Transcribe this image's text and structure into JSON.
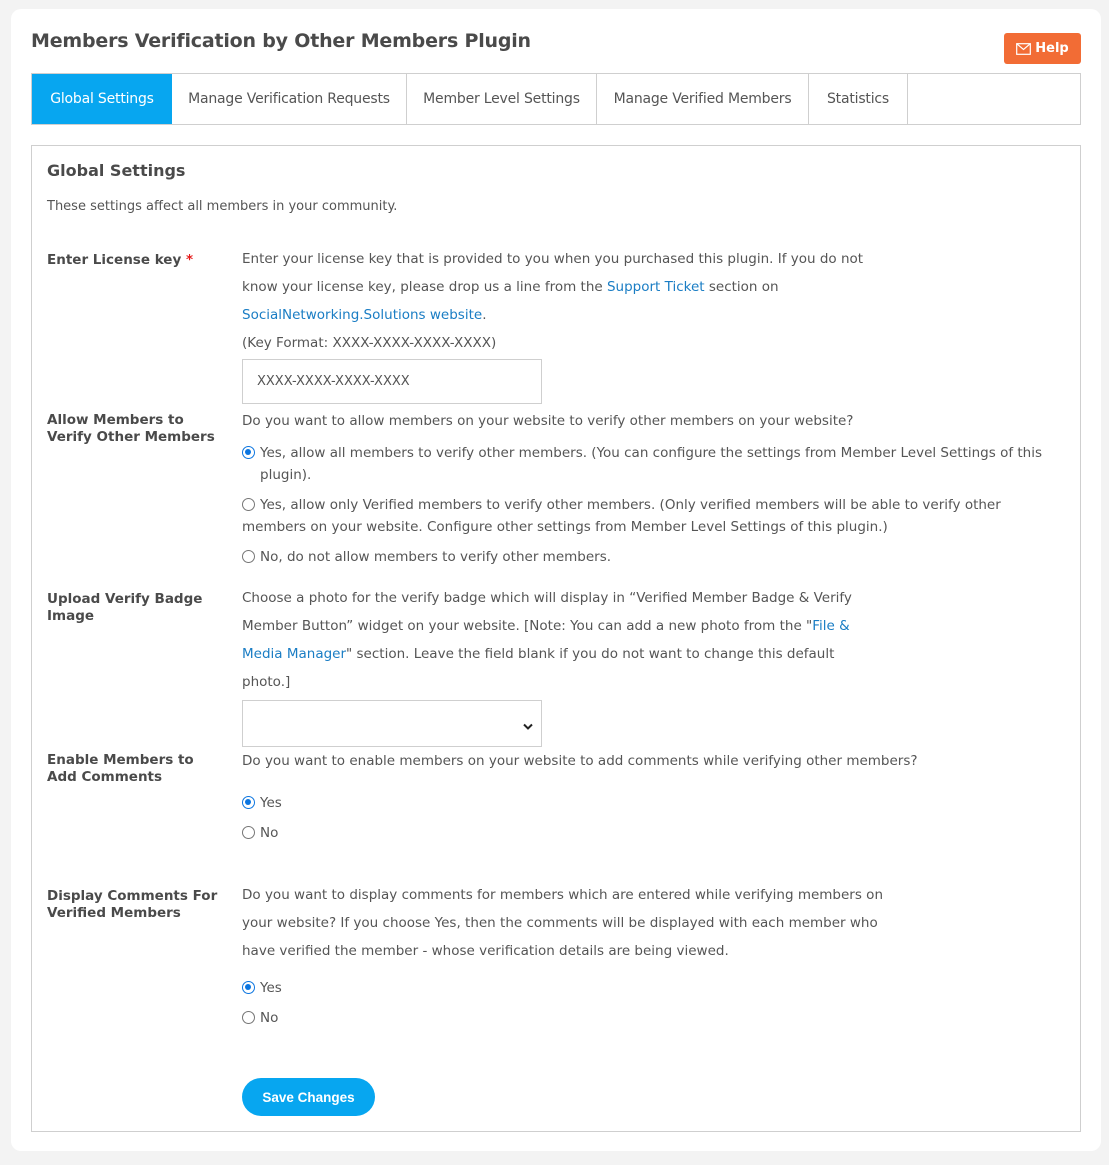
{
  "header": {
    "title": "Members Verification by Other Members Plugin",
    "help_label": "Help",
    "help_icon": "envelope-icon"
  },
  "tabs": [
    {
      "label": "Global Settings",
      "active": true
    },
    {
      "label": "Manage Verification Requests",
      "active": false
    },
    {
      "label": "Member Level Settings",
      "active": false
    },
    {
      "label": "Manage Verified Members",
      "active": false
    },
    {
      "label": "Statistics",
      "active": false
    }
  ],
  "panel": {
    "title": "Global Settings",
    "description": "These settings affect all members in your community."
  },
  "license": {
    "label": "Enter License key",
    "required_mark": "*",
    "text_1": "Enter your license key that is provided to you when you purchased this plugin. If you do not know your license key, please drop us a line from the ",
    "link_1": "Support Ticket",
    "text_2": " section on ",
    "link_2": "SocialNetworking.Solutions website",
    "text_3": ".",
    "format_hint": "(Key Format: XXXX-XXXX-XXXX-XXXX)",
    "input_value": "XXXX-XXXX-XXXX-XXXX"
  },
  "allow_verify": {
    "label": "Allow Members to Verify Other Members",
    "question": "Do you want to allow members on your website to verify other members on your website?",
    "options": [
      {
        "label": "Yes, allow all members to verify other members. (You can configure the settings from Member Level Settings of this plugin).",
        "checked": true
      },
      {
        "label": "Yes, allow only Verified members to verify other members. (Only verified members will be able to verify other members on your website. Configure other settings from Member Level Settings of this plugin.)",
        "checked": false
      },
      {
        "label": "No, do not allow members to verify other members.",
        "checked": false
      }
    ]
  },
  "badge": {
    "label": "Upload Verify Badge Image",
    "text_1": "Choose a photo for the verify badge which will display in “Verified Member Badge & Verify Member Button” widget on your website. [Note: You can add a new photo from the \"",
    "link": "File & Media Manager",
    "text_2": "\" section. Leave the field blank if you do not want to change this default photo.]",
    "select_value": ""
  },
  "comments": {
    "label": "Enable Members to Add Comments",
    "question": "Do you want to enable members on your website to add comments while verifying other members?",
    "options": [
      {
        "label": "Yes",
        "checked": true
      },
      {
        "label": "No",
        "checked": false
      }
    ]
  },
  "display_comments": {
    "label": "Display Comments For Verified Members",
    "question": "Do you want to display comments for members which are entered while verifying members on your website? If you choose Yes, then the comments will be displayed with each member who have verified the member - whose verification details are being viewed.",
    "options": [
      {
        "label": "Yes",
        "checked": true
      },
      {
        "label": "No",
        "checked": false
      }
    ]
  },
  "save_label": "Save Changes",
  "colors": {
    "accent": "#07a6f0",
    "help_button": "#f26c35",
    "link": "#1a7dc4",
    "required": "#e51c1c"
  }
}
